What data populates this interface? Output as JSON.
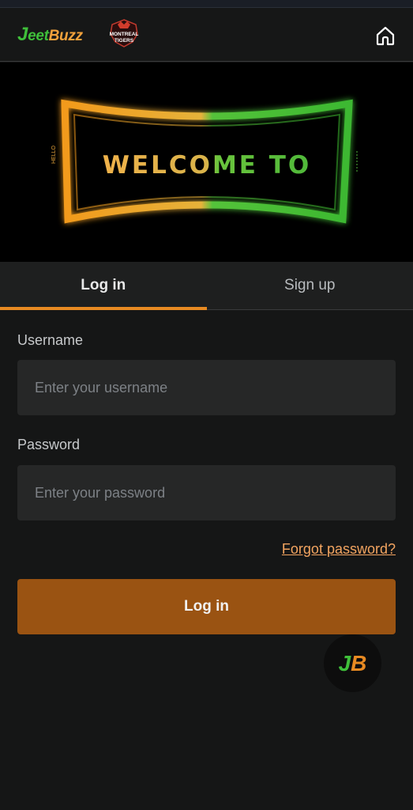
{
  "brand": {
    "logo_letter": "J",
    "logo_part1": "eet",
    "logo_part2": "Buzz",
    "partner_logo_line1": "MONTREAL",
    "partner_logo_line2": "TIGERS"
  },
  "header": {
    "home_icon": "home-icon"
  },
  "banner": {
    "welcome_text": "WELCOME TO",
    "side_text": "HELLO"
  },
  "tabs": [
    {
      "label": "Log in",
      "active": true
    },
    {
      "label": "Sign up",
      "active": false
    }
  ],
  "form": {
    "username_label": "Username",
    "username_placeholder": "Enter your username",
    "password_label": "Password",
    "password_placeholder": "Enter your password",
    "forgot_label": "Forgot password?",
    "submit_label": "Log in"
  },
  "floating": {
    "letter1": "J",
    "letter2": "B"
  },
  "colors": {
    "accent": "#e88a22",
    "button": "#9a5312",
    "green": "#3fbf3a",
    "orange": "#f2a13b"
  }
}
